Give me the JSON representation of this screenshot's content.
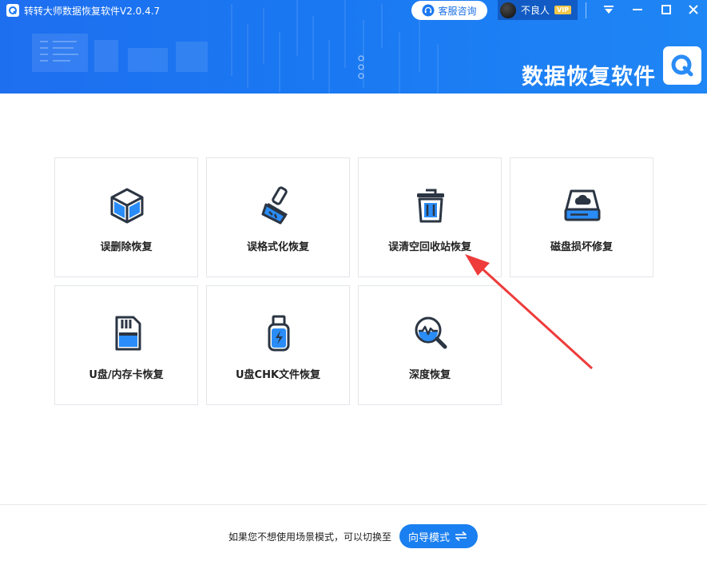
{
  "window": {
    "title": "转转大师数据恢复软件V2.0.4.7",
    "support_label": "客服咨询",
    "user_name": "不良人",
    "vip_badge": "VIP",
    "brand_text": "数据恢复软件"
  },
  "cards": [
    {
      "label": "误删除恢复",
      "icon": "cube-icon"
    },
    {
      "label": "误格式化恢复",
      "icon": "brush-icon"
    },
    {
      "label": "误清空回收站恢复",
      "icon": "trash-icon"
    },
    {
      "label": "磁盘损坏修复",
      "icon": "disk-icon"
    },
    {
      "label": "U盘/内存卡恢复",
      "icon": "sd-card-icon"
    },
    {
      "label": "U盘CHK文件恢复",
      "icon": "usb-drive-icon"
    },
    {
      "label": "深度恢复",
      "icon": "deep-scan-icon"
    }
  ],
  "footer": {
    "prompt_text": "如果您不想使用场景模式，可以切换至",
    "guide_label": "向导模式"
  },
  "colors": {
    "header_blue": "#1a78f2",
    "accent_blue": "#2a8cf7",
    "icon_dark": "#2b3543",
    "arrow_red": "#ee3b3b"
  }
}
